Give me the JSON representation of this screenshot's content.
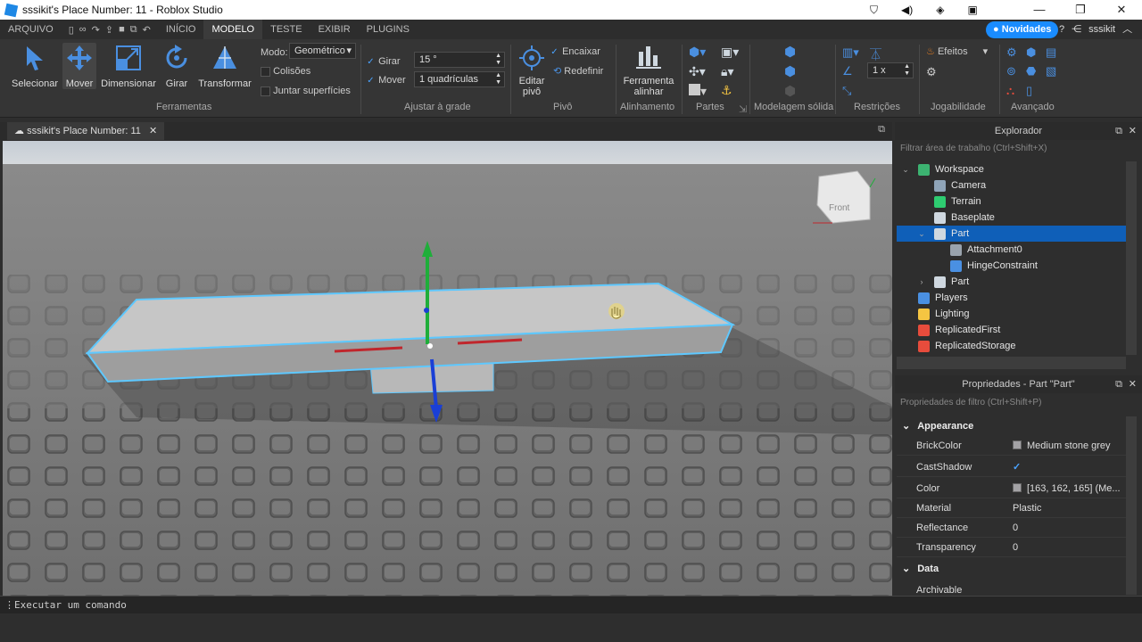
{
  "window": {
    "title": "sssikit's Place Number: 11 - Roblox Studio"
  },
  "menubar": {
    "tabs": [
      "ARQUIVO",
      "INÍCIO",
      "MODELO",
      "TESTE",
      "EXIBIR",
      "PLUGINS"
    ],
    "active": "MODELO",
    "novidades": "Novidades",
    "user": "sssikit"
  },
  "ribbon": {
    "tools": [
      "Selecionar",
      "Mover",
      "Dimensionar",
      "Girar",
      "Transformar"
    ],
    "mode_label": "Modo:",
    "mode_value": "Geométrico",
    "collisions": "Colisões",
    "join_surfaces": "Juntar superfícies",
    "rotate_label": "Girar",
    "rotate_value": "15 °",
    "move_label": "Mover",
    "move_value": "1 quadrículas",
    "edit_pivot": [
      "Editar",
      "pivô"
    ],
    "snap": "Encaixar",
    "reset": "Redefinir",
    "align_tool": [
      "Ferramenta",
      "alinhar"
    ],
    "effects": "Efeitos",
    "scale_value": "1 x",
    "groups": {
      "tools": "Ferramentas",
      "grid": "Ajustar à grade",
      "pivot": "Pivô",
      "align": "Alinhamento",
      "parts": "Partes",
      "csg": "Modelagem sólida",
      "constraints": "Restrições",
      "gameplay": "Jogabilidade",
      "advanced": "Avançado"
    }
  },
  "doc_tab": "sssikit's Place Number: 11",
  "viewcube_label": "Front",
  "explorer": {
    "title": "Explorador",
    "filter_placeholder": "Filtrar área de trabalho (Ctrl+Shift+X)",
    "items": [
      {
        "label": "Workspace",
        "icon": "globe-icon",
        "color": "#3cb371"
      },
      {
        "label": "Camera",
        "icon": "camera-icon",
        "color": "#8fa4b8"
      },
      {
        "label": "Terrain",
        "icon": "terrain-icon",
        "color": "#2ecc71"
      },
      {
        "label": "Baseplate",
        "icon": "part-icon",
        "color": "#cfd8e0"
      },
      {
        "label": "Part",
        "icon": "part-icon",
        "color": "#cfd8e0"
      },
      {
        "label": "Attachment0",
        "icon": "attachment-icon",
        "color": "#9aa3ad"
      },
      {
        "label": "HingeConstraint",
        "icon": "hinge-icon",
        "color": "#4a90e2"
      },
      {
        "label": "Part",
        "icon": "part-icon",
        "color": "#cfd8e0"
      },
      {
        "label": "Players",
        "icon": "players-icon",
        "color": "#4a90e2"
      },
      {
        "label": "Lighting",
        "icon": "lightbulb-icon",
        "color": "#f5c542"
      },
      {
        "label": "ReplicatedFirst",
        "icon": "replicated-icon",
        "color": "#e74c3c"
      },
      {
        "label": "ReplicatedStorage",
        "icon": "storage-icon",
        "color": "#e74c3c"
      }
    ]
  },
  "properties": {
    "title": "Propriedades - Part \"Part\"",
    "filter_placeholder": "Propriedades de filtro (Ctrl+Shift+P)",
    "category_appearance": "Appearance",
    "rows": [
      {
        "name": "BrickColor",
        "value": "Medium stone grey",
        "swatch": "#a3a2a5"
      },
      {
        "name": "CastShadow",
        "value": "✓"
      },
      {
        "name": "Color",
        "value": "[163, 162, 165] (Me...",
        "swatch": "#a3a2a5"
      },
      {
        "name": "Material",
        "value": "Plastic"
      },
      {
        "name": "Reflectance",
        "value": "0"
      },
      {
        "name": "Transparency",
        "value": "0"
      }
    ],
    "category_data": "Data",
    "archivable": "Archivable"
  },
  "command_bar": {
    "placeholder": "Executar um comando"
  }
}
